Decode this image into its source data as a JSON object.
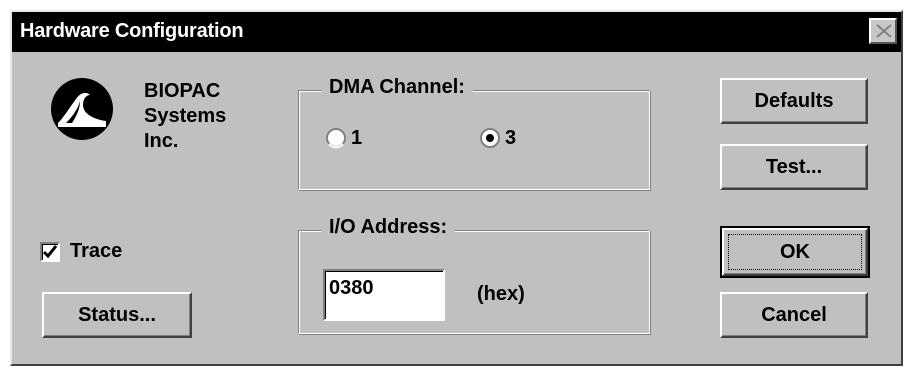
{
  "window": {
    "title": "Hardware Configuration",
    "close_icon": "close-icon"
  },
  "company": {
    "logo_icon": "biopac-wave-logo",
    "line1": "BIOPAC",
    "line2": "Systems",
    "line3": "Inc."
  },
  "dma": {
    "label": "DMA Channel:",
    "options": [
      {
        "label": "1",
        "selected": false
      },
      {
        "label": "3",
        "selected": true
      }
    ]
  },
  "io": {
    "label": "I/O Address:",
    "value": "0380",
    "unit": "(hex)"
  },
  "trace": {
    "label": "Trace",
    "checked": true
  },
  "buttons": {
    "defaults": "Defaults",
    "test": "Test...",
    "ok": "OK",
    "cancel": "Cancel",
    "status": "Status..."
  }
}
